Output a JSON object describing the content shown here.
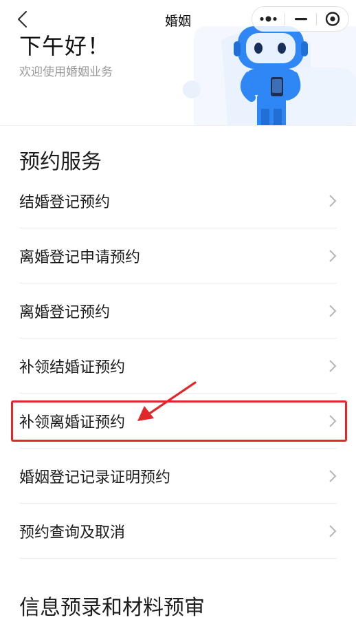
{
  "nav": {
    "title": "婚姻",
    "back_icon": "chevron-left-icon",
    "more_icon": "more-dots-icon",
    "minimize_icon": "minus-icon",
    "close_icon": "target-circle-icon"
  },
  "hero": {
    "greeting": "下午好！",
    "subtitle": "欢迎使用婚姻业务",
    "accent_color": "#2f86f5",
    "bg_shape_color": "#eef5fd"
  },
  "sections": {
    "appointment_title": "预约服务",
    "preentry_title": "信息预录和材料预审"
  },
  "menu": [
    {
      "label": "结婚登记预约"
    },
    {
      "label": "离婚登记申请预约"
    },
    {
      "label": "离婚登记预约"
    },
    {
      "label": "补领结婚证预约"
    },
    {
      "label": "补领离婚证预约",
      "highlighted": true
    },
    {
      "label": "婚姻登记记录证明预约"
    },
    {
      "label": "预约查询及取消"
    }
  ],
  "annotation": {
    "color": "#e0282b",
    "highlighted_item": "补领离婚证预约"
  }
}
